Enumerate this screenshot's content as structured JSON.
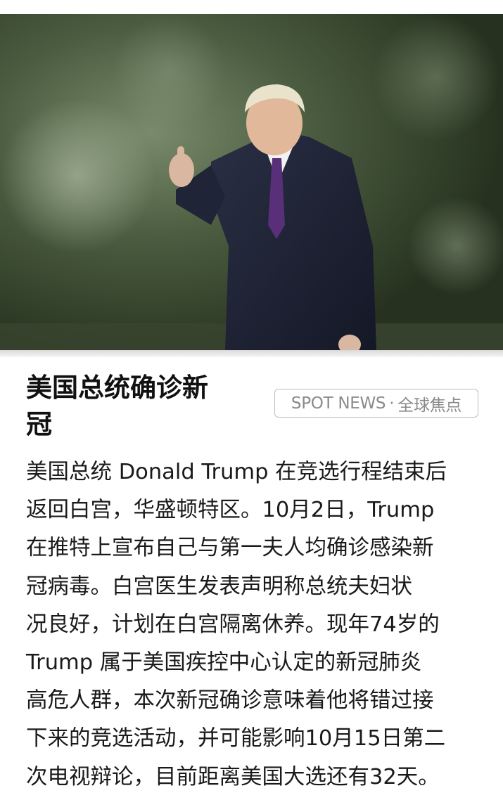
{
  "article": {
    "photo_alt": "Donald Trump giving a thumbs up",
    "headline_line1": "美国总统确诊新",
    "headline_line2": "冠",
    "badge": {
      "source": "SPOT NEWS",
      "separator": "·",
      "category": "全球焦点"
    },
    "body_lines": [
      "美国总统 Donald Trump 在竞选行程结束后",
      "返回白宫，华盛顿特区。10月2日，Trump",
      "在推特上宣布自己与第一夫人均确诊感染新",
      "冠病毒。白宫医生发表声明称总统夫妇状",
      "况良好，计划在白宫隔离休养。现年74岁的",
      "Trump 属于美国疾控中心认定的新冠肺炎",
      "高危人群，本次新冠确诊意味着他将错过接",
      "下来的竞选活动，并可能影响10月15日第二",
      "次电视辩论，目前距离美国大选还有32天。"
    ]
  },
  "colors": {
    "headline": "#111111",
    "body": "#1a1a1a",
    "badge_text": "#8a8a8a",
    "badge_border": "#bdbdbd"
  }
}
